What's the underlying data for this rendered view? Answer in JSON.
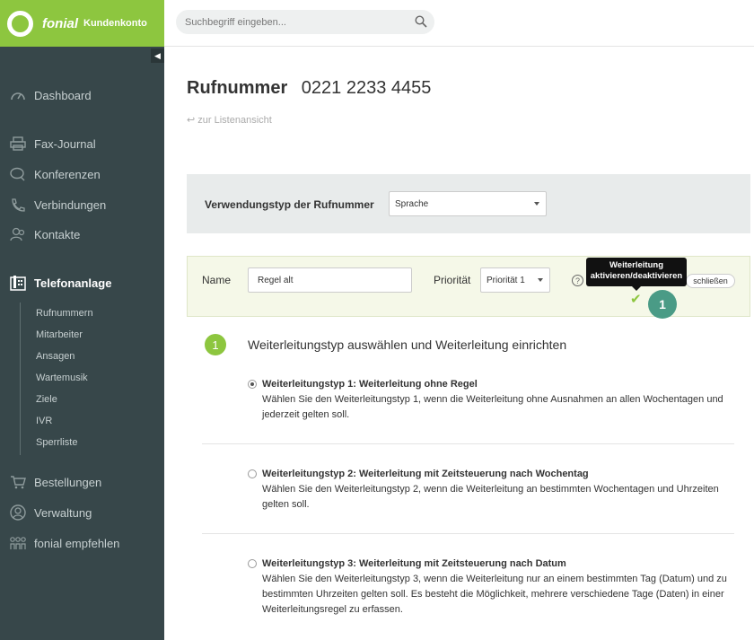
{
  "brand": {
    "name": "fonial",
    "sub": "Kundenkonto"
  },
  "search": {
    "placeholder": "Suchbegriff eingeben..."
  },
  "sidebar": {
    "items": [
      {
        "label": "Dashboard"
      },
      {
        "label": "Fax-Journal"
      },
      {
        "label": "Konferenzen"
      },
      {
        "label": "Verbindungen"
      },
      {
        "label": "Kontakte"
      },
      {
        "label": "Telefonanlage"
      },
      {
        "label": "Bestellungen"
      },
      {
        "label": "Verwaltung"
      },
      {
        "label": "fonial empfehlen"
      }
    ],
    "subitems": [
      {
        "label": "Rufnummern"
      },
      {
        "label": "Mitarbeiter"
      },
      {
        "label": "Ansagen"
      },
      {
        "label": "Wartemusik"
      },
      {
        "label": "Ziele"
      },
      {
        "label": "IVR"
      },
      {
        "label": "Sperrliste"
      }
    ]
  },
  "page": {
    "title_label": "Rufnummer",
    "number": "0221 2233 4455",
    "back_link": "zur Listenansicht"
  },
  "usage": {
    "label": "Verwendungstyp der Rufnummer",
    "selected": "Sprache"
  },
  "rule": {
    "name_label": "Name",
    "name_value": "Regel alt",
    "priority_label": "Priorität",
    "priority_selected": "Priorität 1",
    "help": "?",
    "close": "schließen",
    "badge": "1",
    "tooltip_line1": "Weiterleitung",
    "tooltip_line2": "aktivieren/deaktivieren"
  },
  "section": {
    "number": "1",
    "title": "Weiterleitungstyp auswählen und Weiterleitung einrichten"
  },
  "options": [
    {
      "title": "Weiterleitungstyp 1: Weiterleitung ohne Regel",
      "desc": "Wählen Sie den Weiterleitungstyp 1, wenn die Weiterleitung ohne Ausnahmen an allen Wochentagen und jederzeit gelten soll.",
      "checked": true
    },
    {
      "title": "Weiterleitungstyp 2: Weiterleitung mit Zeitsteuerung nach Wochentag",
      "desc": "Wählen Sie den Weiterleitungstyp 2, wenn die Weiterleitung an bestimmten Wochentagen und Uhrzeiten gelten soll.",
      "checked": false
    },
    {
      "title": "Weiterleitungstyp 3: Weiterleitung mit Zeitsteuerung nach Datum",
      "desc": "Wählen Sie den Weiterleitungstyp 3, wenn die Weiterleitung nur an einem bestimmten Tag (Datum) und zu bestimmten Uhrzeiten gelten soll. Es besteht die Möglichkeit, mehrere verschiedene Tage (Daten) in einer Weiterleitungsregel zu erfassen.",
      "checked": false
    }
  ]
}
